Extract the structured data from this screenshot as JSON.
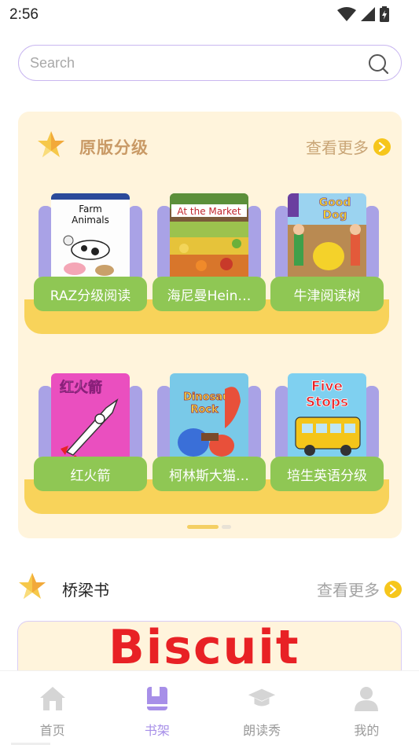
{
  "status_bar": {
    "time": "2:56"
  },
  "search": {
    "placeholder": "Search"
  },
  "graded": {
    "title": "原版分级",
    "more": "查看更多",
    "rows": [
      [
        {
          "label": "RAZ分级阅读",
          "cover_text": "Farm Animals"
        },
        {
          "label": "海尼曼Hein…",
          "cover_text": "At the Market"
        },
        {
          "label": "牛津阅读树",
          "cover_text": "Good Dog"
        }
      ],
      [
        {
          "label": "红火箭",
          "cover_text": "红火箭"
        },
        {
          "label": "柯林斯大猫…",
          "cover_text": "Dinosaur Rock"
        },
        {
          "label": "培生英语分级",
          "cover_text": "Five Stops"
        }
      ]
    ]
  },
  "bridge": {
    "title": "桥梁书",
    "more": "查看更多",
    "banner_text": "Biscuit"
  },
  "tabs": [
    {
      "label": "首页",
      "icon": "home-icon"
    },
    {
      "label": "书架",
      "icon": "bookshelf-icon",
      "active": true
    },
    {
      "label": "朗读秀",
      "icon": "graduation-cap-icon"
    },
    {
      "label": "我的",
      "icon": "user-icon"
    }
  ],
  "colors": {
    "accent": "#a78fe8",
    "card_bg": "#fff4dc",
    "label_green": "#8fc754",
    "shelf_yellow": "#f8d35a",
    "more_arrow": "#f6c61c"
  }
}
